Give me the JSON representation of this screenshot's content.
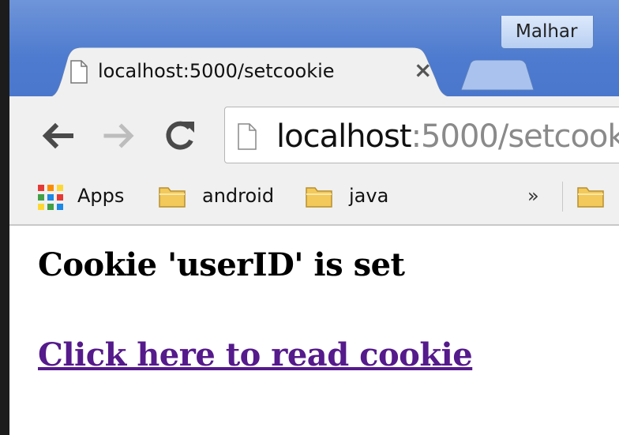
{
  "browser": {
    "profile_name": "Malhar",
    "tabs": [
      {
        "title": "localhost:5000/setcookie",
        "close_glyph": "×",
        "icon": "page-icon"
      }
    ],
    "new_tab_icon": "new-tab-icon",
    "nav": {
      "back_icon": "back-arrow-icon",
      "forward_icon": "forward-arrow-icon",
      "reload_icon": "reload-icon"
    },
    "address": {
      "host": "localhost",
      "path": ":5000/setcook"
    },
    "bookmarks": [
      {
        "label": "Apps",
        "icon": "apps-grid-icon"
      },
      {
        "label": "android",
        "icon": "folder-icon"
      },
      {
        "label": "java",
        "icon": "folder-icon"
      }
    ],
    "overflow_glyph": "»"
  },
  "page": {
    "heading": "Cookie 'userID' is set",
    "link_text": "Click here to read cookie",
    "link_color": "#551a8b"
  },
  "colors": {
    "titlebar": "#4e7bcf",
    "toolbar": "#f0f0f0"
  }
}
